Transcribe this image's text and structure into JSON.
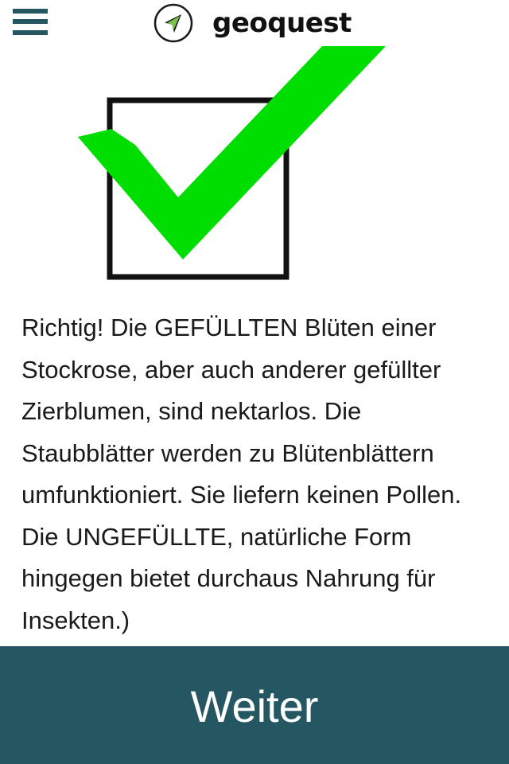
{
  "header": {
    "menu_icon": "hamburger-menu-icon",
    "logo_icon": "compass-arrow-icon",
    "logo_text": "geoquest"
  },
  "feedback": {
    "icon": "green-checkmark-in-box",
    "check_color": "#00dd00",
    "message": "Richtig! Die GEFÜLLTEN Blüten einer Stockrose, aber auch anderer gefüllter Zierblumen, sind nektarlos. Die Staubblätter werden zu Blütenblättern umfunktioniert. Sie liefern keinen Pollen. Die UNGEFÜLLTE, natürliche Form hingegen bietet durchaus Nahrung für Insekten.)"
  },
  "footer": {
    "continue_label": "Weiter"
  },
  "colors": {
    "accent": "#255762",
    "check": "#00dd00",
    "text": "#1a1a1a"
  }
}
